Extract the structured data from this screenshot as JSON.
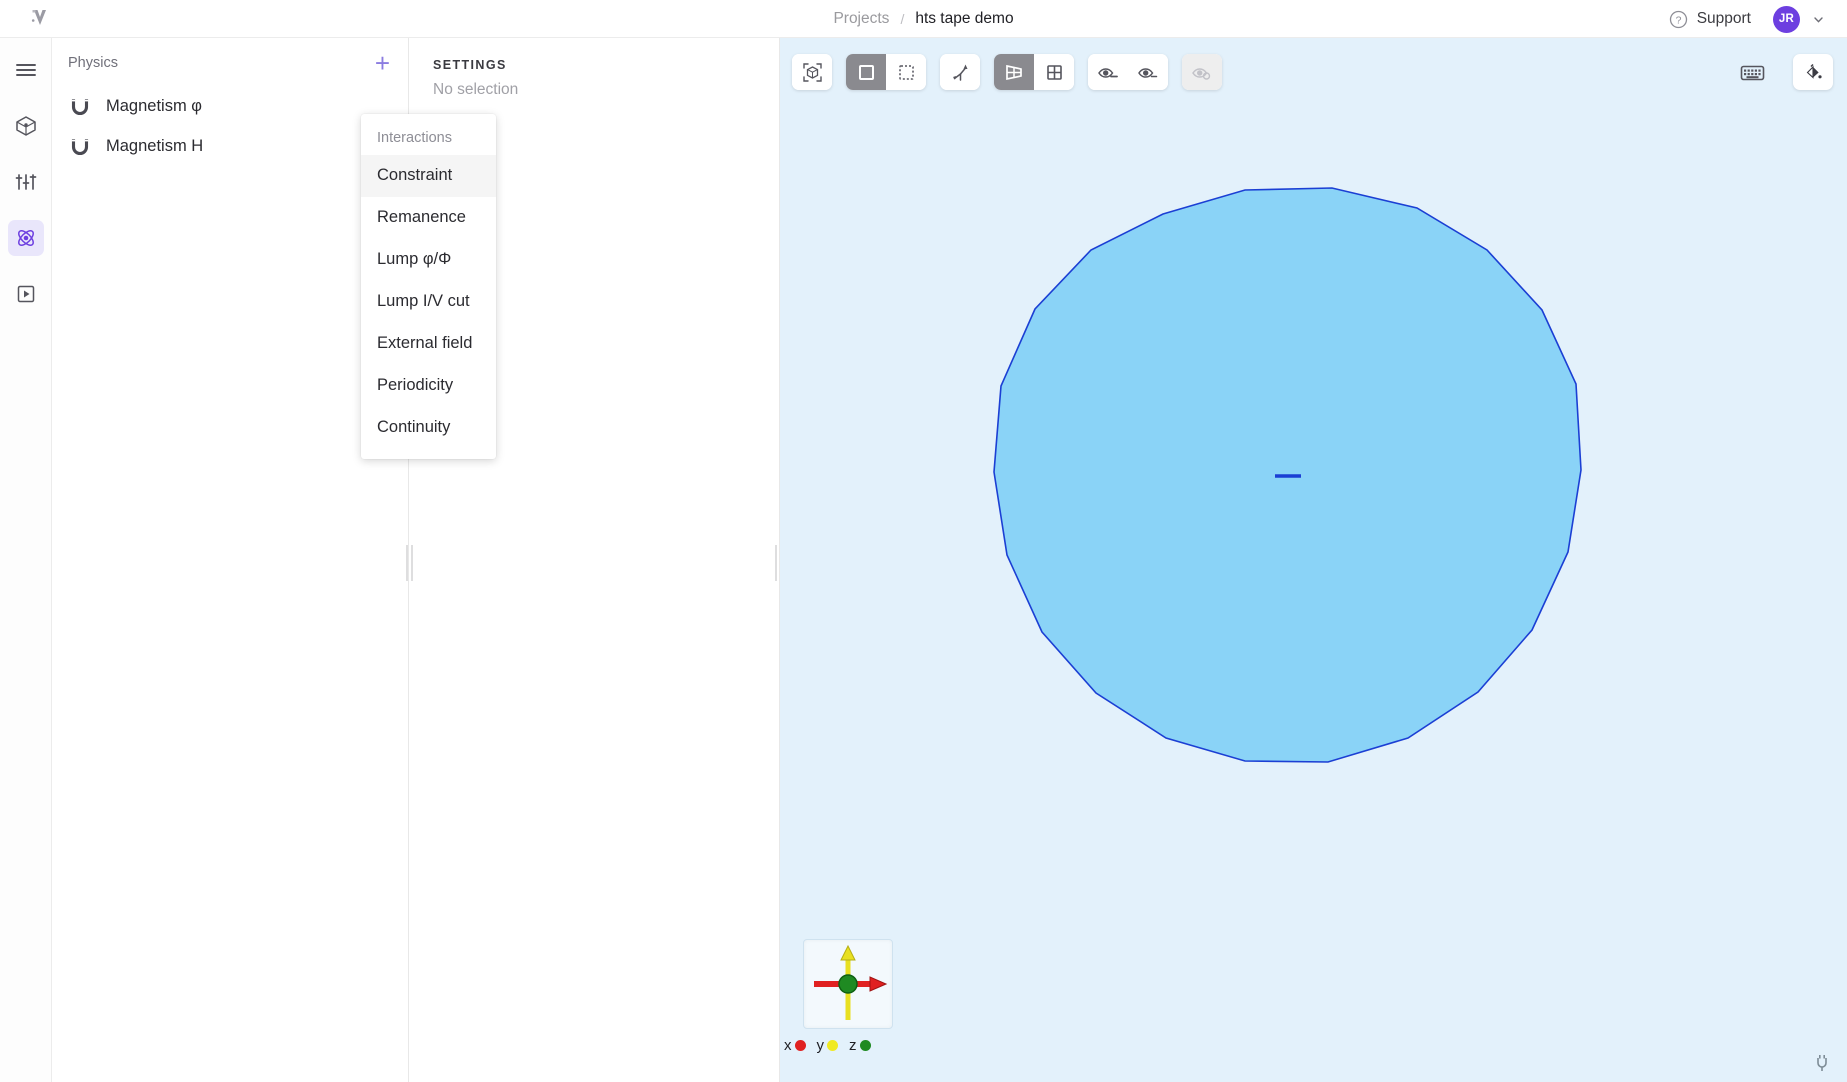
{
  "topbar": {
    "logo_name": "vector-logo",
    "breadcrumb": {
      "root": "Projects",
      "separator": "/",
      "current": "hts tape demo"
    },
    "support_label": "Support",
    "avatar_initials": "JR",
    "help_icon": "question-circle-icon",
    "chevron_icon": "chevron-down-icon"
  },
  "rail": {
    "items": [
      {
        "name": "menu-icon",
        "label": "Menu",
        "active": false
      },
      {
        "name": "geometry-cube-icon",
        "label": "Geometry",
        "active": false
      },
      {
        "name": "sliders-icon",
        "label": "Parameters",
        "active": false
      },
      {
        "name": "atom-icon",
        "label": "Physics",
        "active": true
      },
      {
        "name": "play-box-icon",
        "label": "Run",
        "active": false
      }
    ],
    "active_color": "#6d3fe0",
    "active_bg": "#e9e6fb"
  },
  "physics_panel": {
    "title": "Physics",
    "add_button_label": "+",
    "items": [
      {
        "icon": "magnet-icon",
        "label": "Magnetism φ"
      },
      {
        "icon": "magnet-icon",
        "label": "Magnetism H"
      }
    ],
    "layers_button_name": "add-layer-icon"
  },
  "settings_panel": {
    "heading": "SETTINGS",
    "empty_state": "No selection"
  },
  "dropdown": {
    "header": "Interactions",
    "highlighted_index": 0,
    "items": [
      "Constraint",
      "Remanence",
      "Lump φ/Φ",
      "Lump I/V cut",
      "External field",
      "Periodicity",
      "Continuity"
    ]
  },
  "canvas": {
    "background": "#e3f1fb",
    "toolbar_left": [
      {
        "group": [
          {
            "name": "fit-to-view-icon",
            "active": false
          }
        ]
      },
      {
        "group": [
          {
            "name": "select-solid-icon",
            "active": true
          },
          {
            "name": "select-dashed-icon",
            "active": false
          }
        ]
      },
      {
        "group": [
          {
            "name": "transform-axes-icon",
            "active": false
          }
        ]
      },
      {
        "group": [
          {
            "name": "perspective-view-icon",
            "active": true
          },
          {
            "name": "grid-view-icon",
            "active": false
          }
        ]
      },
      {
        "group": [
          {
            "name": "hide-eye-icon",
            "active": false
          },
          {
            "name": "show-eye-icon",
            "active": false
          }
        ]
      },
      {
        "group": [
          {
            "name": "eye-disabled-icon",
            "active": false,
            "disabled": true
          }
        ]
      }
    ],
    "toolbar_right": [
      {
        "name": "keyboard-icon"
      },
      {
        "name": "paint-fill-icon"
      }
    ],
    "shape": {
      "name": "circle-polygon",
      "fill": "#8ad3f7",
      "stroke": "#1b3fd4",
      "center_marker": "center-line"
    },
    "gizmo": {
      "name": "axis-gizmo",
      "x_color": "#e02121",
      "y_color": "#e8e021",
      "z_color": "#1f8a22"
    },
    "axis_legend": [
      {
        "label": "x",
        "color": "#e02121"
      },
      {
        "label": "y",
        "color": "#f0ea22"
      },
      {
        "label": "z",
        "color": "#1f8a22"
      }
    ],
    "plug_icon": "power-plug-icon"
  }
}
